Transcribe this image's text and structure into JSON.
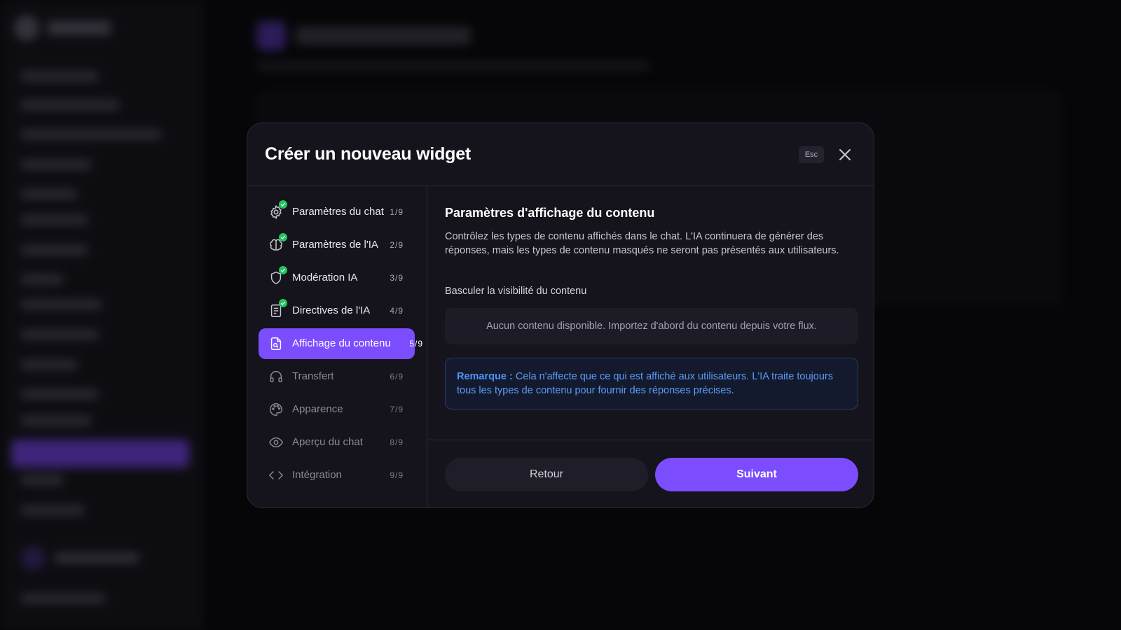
{
  "modal": {
    "title": "Créer un nouveau widget",
    "esc_label": "Esc",
    "close_icon": "close-icon"
  },
  "steps": [
    {
      "label": "Paramètres du chat",
      "count": "1/9",
      "status": "done",
      "icon": "gear-icon"
    },
    {
      "label": "Paramètres de l'IA",
      "count": "2/9",
      "status": "done",
      "icon": "brain-icon"
    },
    {
      "label": "Modération IA",
      "count": "3/9",
      "status": "done",
      "icon": "shield-icon"
    },
    {
      "label": "Directives de l'IA",
      "count": "4/9",
      "status": "done",
      "icon": "document-icon"
    },
    {
      "label": "Affichage du contenu",
      "count": "5/9",
      "status": "active",
      "icon": "file-search-icon"
    },
    {
      "label": "Transfert",
      "count": "6/9",
      "status": "pending",
      "icon": "headphones-icon"
    },
    {
      "label": "Apparence",
      "count": "7/9",
      "status": "pending",
      "icon": "palette-icon"
    },
    {
      "label": "Aperçu du chat",
      "count": "8/9",
      "status": "pending",
      "icon": "eye-icon"
    },
    {
      "label": "Intégration",
      "count": "9/9",
      "status": "pending",
      "icon": "code-icon"
    }
  ],
  "content": {
    "title": "Paramètres d'affichage du contenu",
    "description": "Contrôlez les types de contenu affichés dans le chat. L'IA continuera de générer des réponses, mais les types de contenu masqués ne seront pas présentés aux utilisateurs.",
    "toggle_label": "Basculer la visibilité du contenu",
    "empty_message": "Aucun contenu disponible. Importez d'abord du contenu depuis votre flux.",
    "note_prefix": "Remarque :",
    "note_text": "Cela n'affecte que ce qui est affiché aux utilisateurs. L'IA traite toujours tous les types de contenu pour fournir des réponses précises."
  },
  "footer": {
    "back_label": "Retour",
    "next_label": "Suivant"
  },
  "colors": {
    "accent": "#7c4dff",
    "success": "#22c55e",
    "note_text": "#5b9cf5",
    "modal_bg": "#15131c"
  }
}
